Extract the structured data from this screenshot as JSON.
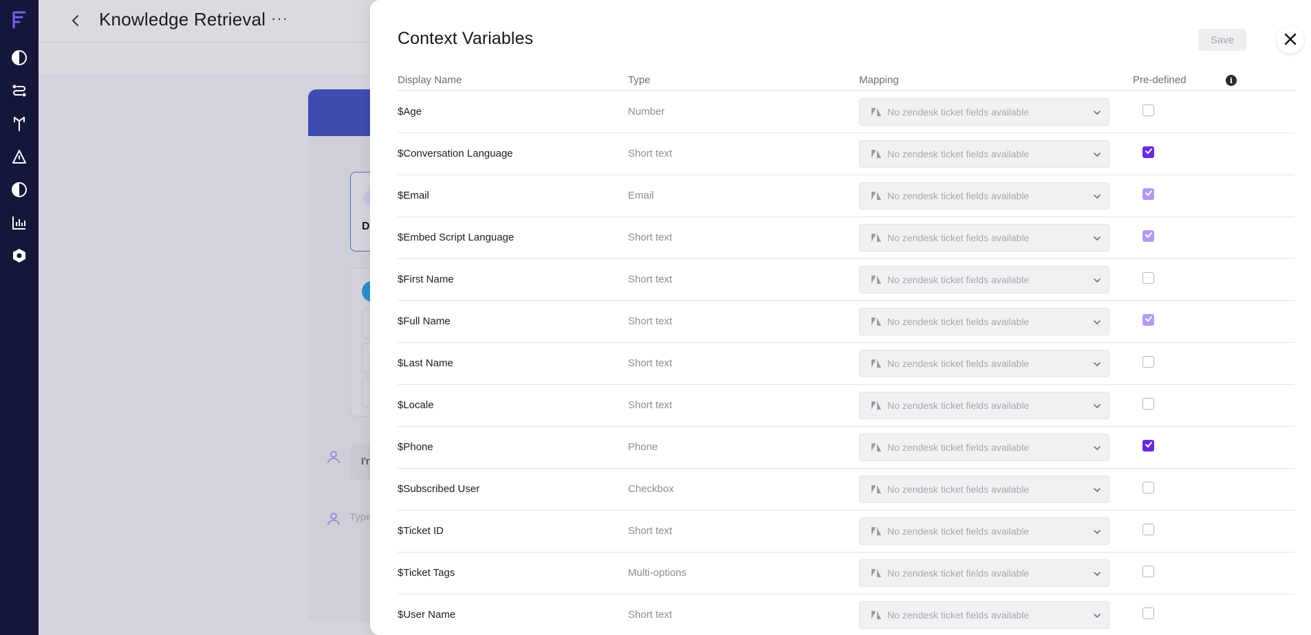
{
  "page": {
    "title": "Knowledge Retrieval",
    "more_label": "···",
    "chat_bubble_text": "I'n",
    "chat_input_placeholder": "Type"
  },
  "modal": {
    "title": "Context Variables",
    "save_label": "Save",
    "columns": {
      "display_name": "Display Name",
      "type": "Type",
      "mapping": "Mapping",
      "predefined": "Pre-defined"
    },
    "rows": [
      {
        "name": "$Age",
        "type": "Number",
        "mapping": "No zendesk ticket fields available",
        "predefined": "unchecked"
      },
      {
        "name": "$Conversation Language",
        "type": "Short text",
        "mapping": "No zendesk ticket fields available",
        "predefined": "checked"
      },
      {
        "name": "$Email",
        "type": "Email",
        "mapping": "No zendesk ticket fields available",
        "predefined": "checked-disabled"
      },
      {
        "name": "$Embed Script Language",
        "type": "Short text",
        "mapping": "No zendesk ticket fields available",
        "predefined": "checked-disabled"
      },
      {
        "name": "$First Name",
        "type": "Short text",
        "mapping": "No zendesk ticket fields available",
        "predefined": "unchecked"
      },
      {
        "name": "$Full Name",
        "type": "Short text",
        "mapping": "No zendesk ticket fields available",
        "predefined": "checked-disabled"
      },
      {
        "name": "$Last Name",
        "type": "Short text",
        "mapping": "No zendesk ticket fields available",
        "predefined": "unchecked"
      },
      {
        "name": "$Locale",
        "type": "Short text",
        "mapping": "No zendesk ticket fields available",
        "predefined": "unchecked"
      },
      {
        "name": "$Phone",
        "type": "Phone",
        "mapping": "No zendesk ticket fields available",
        "predefined": "checked"
      },
      {
        "name": "$Subscribed User",
        "type": "Checkbox",
        "mapping": "No zendesk ticket fields available",
        "predefined": "unchecked"
      },
      {
        "name": "$Ticket ID",
        "type": "Short text",
        "mapping": "No zendesk ticket fields available",
        "predefined": "unchecked"
      },
      {
        "name": "$Ticket Tags",
        "type": "Multi-options",
        "mapping": "No zendesk ticket fields available",
        "predefined": "unchecked"
      },
      {
        "name": "$User Name",
        "type": "Short text",
        "mapping": "No zendesk ticket fields available",
        "predefined": "unchecked"
      }
    ]
  },
  "colors": {
    "rail": "#15173a",
    "accent": "#6a2be0",
    "accent_soft": "#b39af0",
    "banner": "#3f4db3"
  },
  "icons": {
    "rail": [
      "forethought-logo-icon",
      "contrast-icon",
      "workflow-icon",
      "split-arrows-icon",
      "triangle-a-icon",
      "contrast-icon",
      "bar-chart-icon",
      "hexagon-gear-icon"
    ],
    "modal": [
      "close-icon",
      "info-icon",
      "zendesk-icon",
      "chevron-down-icon",
      "checkmark-icon"
    ]
  }
}
